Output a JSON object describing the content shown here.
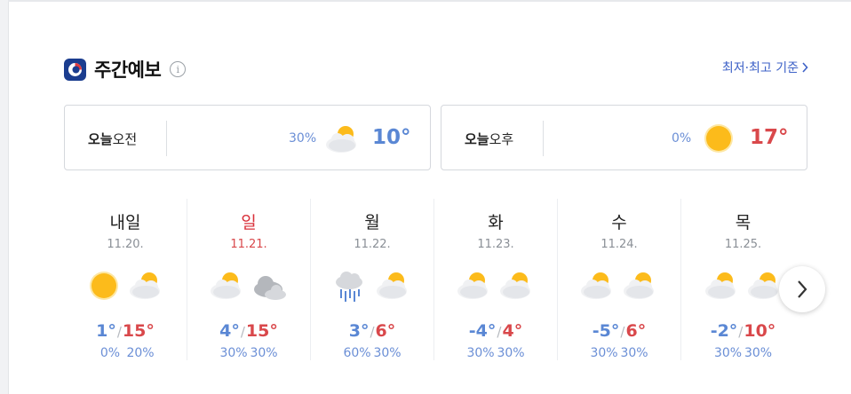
{
  "header": {
    "title": "주간예보",
    "criteria_link": "최저·최고 기준"
  },
  "today": {
    "am": {
      "label_bold": "오늘",
      "label_rest": "오전",
      "pop": "30%",
      "icon": "partly-cloudy-icon",
      "temp": "10°"
    },
    "pm": {
      "label_bold": "오늘",
      "label_rest": "오후",
      "pop": "0%",
      "icon": "sunny-icon",
      "temp": "17°"
    }
  },
  "days": [
    {
      "name": "내일",
      "date": "11.20.",
      "sunday": false,
      "am_icon": "sunny-icon",
      "pm_icon": "partly-cloudy-icon",
      "min": "1°",
      "max": "15°",
      "pop_am": "0%",
      "pop_pm": "20%"
    },
    {
      "name": "일",
      "date": "11.21.",
      "sunday": true,
      "am_icon": "partly-cloudy-icon",
      "pm_icon": "cloudy-icon",
      "min": "4°",
      "max": "15°",
      "pop_am": "30%",
      "pop_pm": "30%"
    },
    {
      "name": "월",
      "date": "11.22.",
      "sunday": false,
      "am_icon": "rain-icon",
      "pm_icon": "partly-cloudy-icon",
      "min": "3°",
      "max": "6°",
      "pop_am": "60%",
      "pop_pm": "30%"
    },
    {
      "name": "화",
      "date": "11.23.",
      "sunday": false,
      "am_icon": "partly-cloudy-icon",
      "pm_icon": "partly-cloudy-icon",
      "min": "-4°",
      "max": "4°",
      "pop_am": "30%",
      "pop_pm": "30%"
    },
    {
      "name": "수",
      "date": "11.24.",
      "sunday": false,
      "am_icon": "partly-cloudy-icon",
      "pm_icon": "partly-cloudy-icon",
      "min": "-5°",
      "max": "6°",
      "pop_am": "30%",
      "pop_pm": "30%"
    },
    {
      "name": "목",
      "date": "11.25.",
      "sunday": false,
      "am_icon": "partly-cloudy-icon",
      "pm_icon": "partly-cloudy-icon",
      "min": "-2°",
      "max": "10°",
      "pop_am": "30%",
      "pop_pm": "30%"
    }
  ],
  "colors": {
    "cold": "#5a87d4",
    "hot": "#d9484b",
    "pop": "#6b8fd6",
    "link": "#3d61c7",
    "sunday": "#d9303a"
  }
}
